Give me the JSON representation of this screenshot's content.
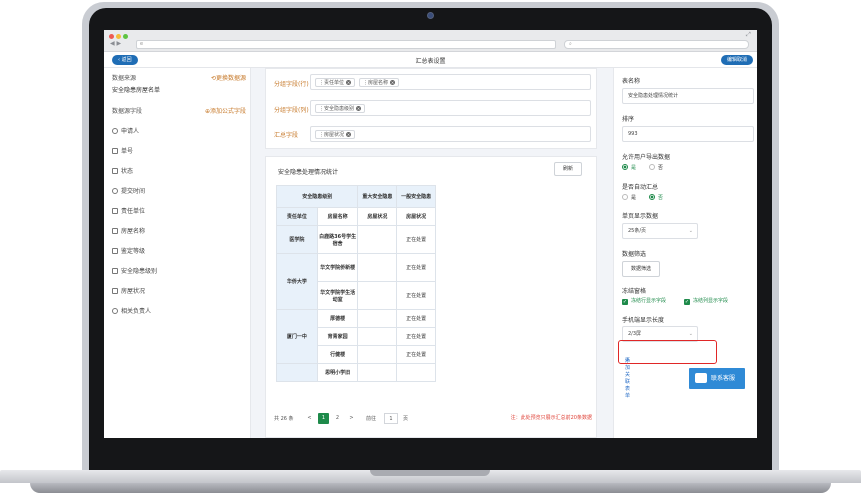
{
  "browser": {
    "url": "e",
    "back_glyph": "◀",
    "forward_glyph": "▶",
    "expand_glyph": "⤢"
  },
  "header": {
    "back_label": "返回",
    "title": "汇总表设置",
    "edit_label": "编辑取消"
  },
  "left": {
    "source_label": "数据来源",
    "change_source_label": "更换数据源",
    "source_name": "安全隐患房屋名单",
    "fields_label": "数据源字段",
    "add_formula_label": "添加公式字段",
    "fields": [
      {
        "label": "申请人",
        "icon": "user-icon"
      },
      {
        "label": "单号",
        "icon": "document-icon"
      },
      {
        "label": "状态",
        "icon": "document-icon"
      },
      {
        "label": "提交时间",
        "icon": "clock-icon"
      },
      {
        "label": "责任单位",
        "icon": "document-icon"
      },
      {
        "label": "房屋名称",
        "icon": "document-icon"
      },
      {
        "label": "鉴定等级",
        "icon": "document-icon"
      },
      {
        "label": "安全隐患级别",
        "icon": "document-icon"
      },
      {
        "label": "房屋状况",
        "icon": "document-icon"
      },
      {
        "label": "相关负责人",
        "icon": "user-icon"
      }
    ]
  },
  "config": {
    "row_group_label": "分组字段(行)",
    "row_tags": [
      "责任单位",
      "房屋名称"
    ],
    "col_group_label": "分组字段(列)",
    "col_tags": [
      "安全隐患级别"
    ],
    "summary_label": "汇总字段",
    "summary_tags": [
      "房屋状况"
    ]
  },
  "preview": {
    "title": "安全隐患处理情况统计",
    "refresh_label": "刷新",
    "header_row1": [
      "安全隐患级别",
      "重大安全隐患",
      "一般安全隐患"
    ],
    "header_row2": [
      "责任单位",
      "房屋名称",
      "房屋状况",
      "房屋状况"
    ],
    "rows": [
      {
        "group": "医学院",
        "name": "白鹿路36号学生宿舍",
        "major": "",
        "general": "正在处置",
        "span": 1
      },
      {
        "group": "华侨大学",
        "name": "华文学院侨新楼",
        "major": "",
        "general": "正在处置",
        "span": 2
      },
      {
        "group": "",
        "name": "华文学院学生活动室",
        "major": "",
        "general": "正在处置",
        "span": 0
      },
      {
        "group": "厦门一中",
        "name": "厚德楼",
        "major": "",
        "general": "正在处置",
        "span": 3
      },
      {
        "group": "",
        "name": "育青家园",
        "major": "",
        "general": "正在处置",
        "span": 0
      },
      {
        "group": "",
        "name": "行健楼",
        "major": "",
        "general": "正在处置",
        "span": 0
      },
      {
        "group": "",
        "name": "思明小学旧",
        "major": "",
        "general": "",
        "span": 1
      }
    ],
    "pager": {
      "total": "共 26 条",
      "prev": "<",
      "pages": [
        "1",
        "2"
      ],
      "next": ">",
      "goto_label": "前往",
      "goto_value": "1",
      "page_unit": "页"
    },
    "note": "注：此处预览只展示汇总前20条数据"
  },
  "right": {
    "table_name_label": "表名称",
    "table_name_value": "安全隐患处理情况统计",
    "sort_label": "排序",
    "sort_value": "993",
    "export_label": "允许用户导出数据",
    "export_yes": "是",
    "export_no": "否",
    "auto_sum_label": "是否自动汇总",
    "auto_sum_yes": "是",
    "auto_sum_no": "否",
    "page_size_label": "单页显示数据",
    "page_size_value": "25条/页",
    "filter_label": "数据筛选",
    "filter_button": "数据筛选",
    "freeze_label": "冻结窗格",
    "freeze_row": "冻结行显示字段",
    "freeze_col": "冻结列显示字段",
    "mobile_label": "手机端显示长度",
    "mobile_value": "2/3屏",
    "add_related_label": "添加关联表单",
    "contact_label": "联系客服"
  },
  "colors": {
    "primary": "#1f6db5",
    "accent_orange": "#c77a2b",
    "success": "#1e8a4a",
    "alert": "#e02727",
    "service": "#2f8ad6"
  }
}
